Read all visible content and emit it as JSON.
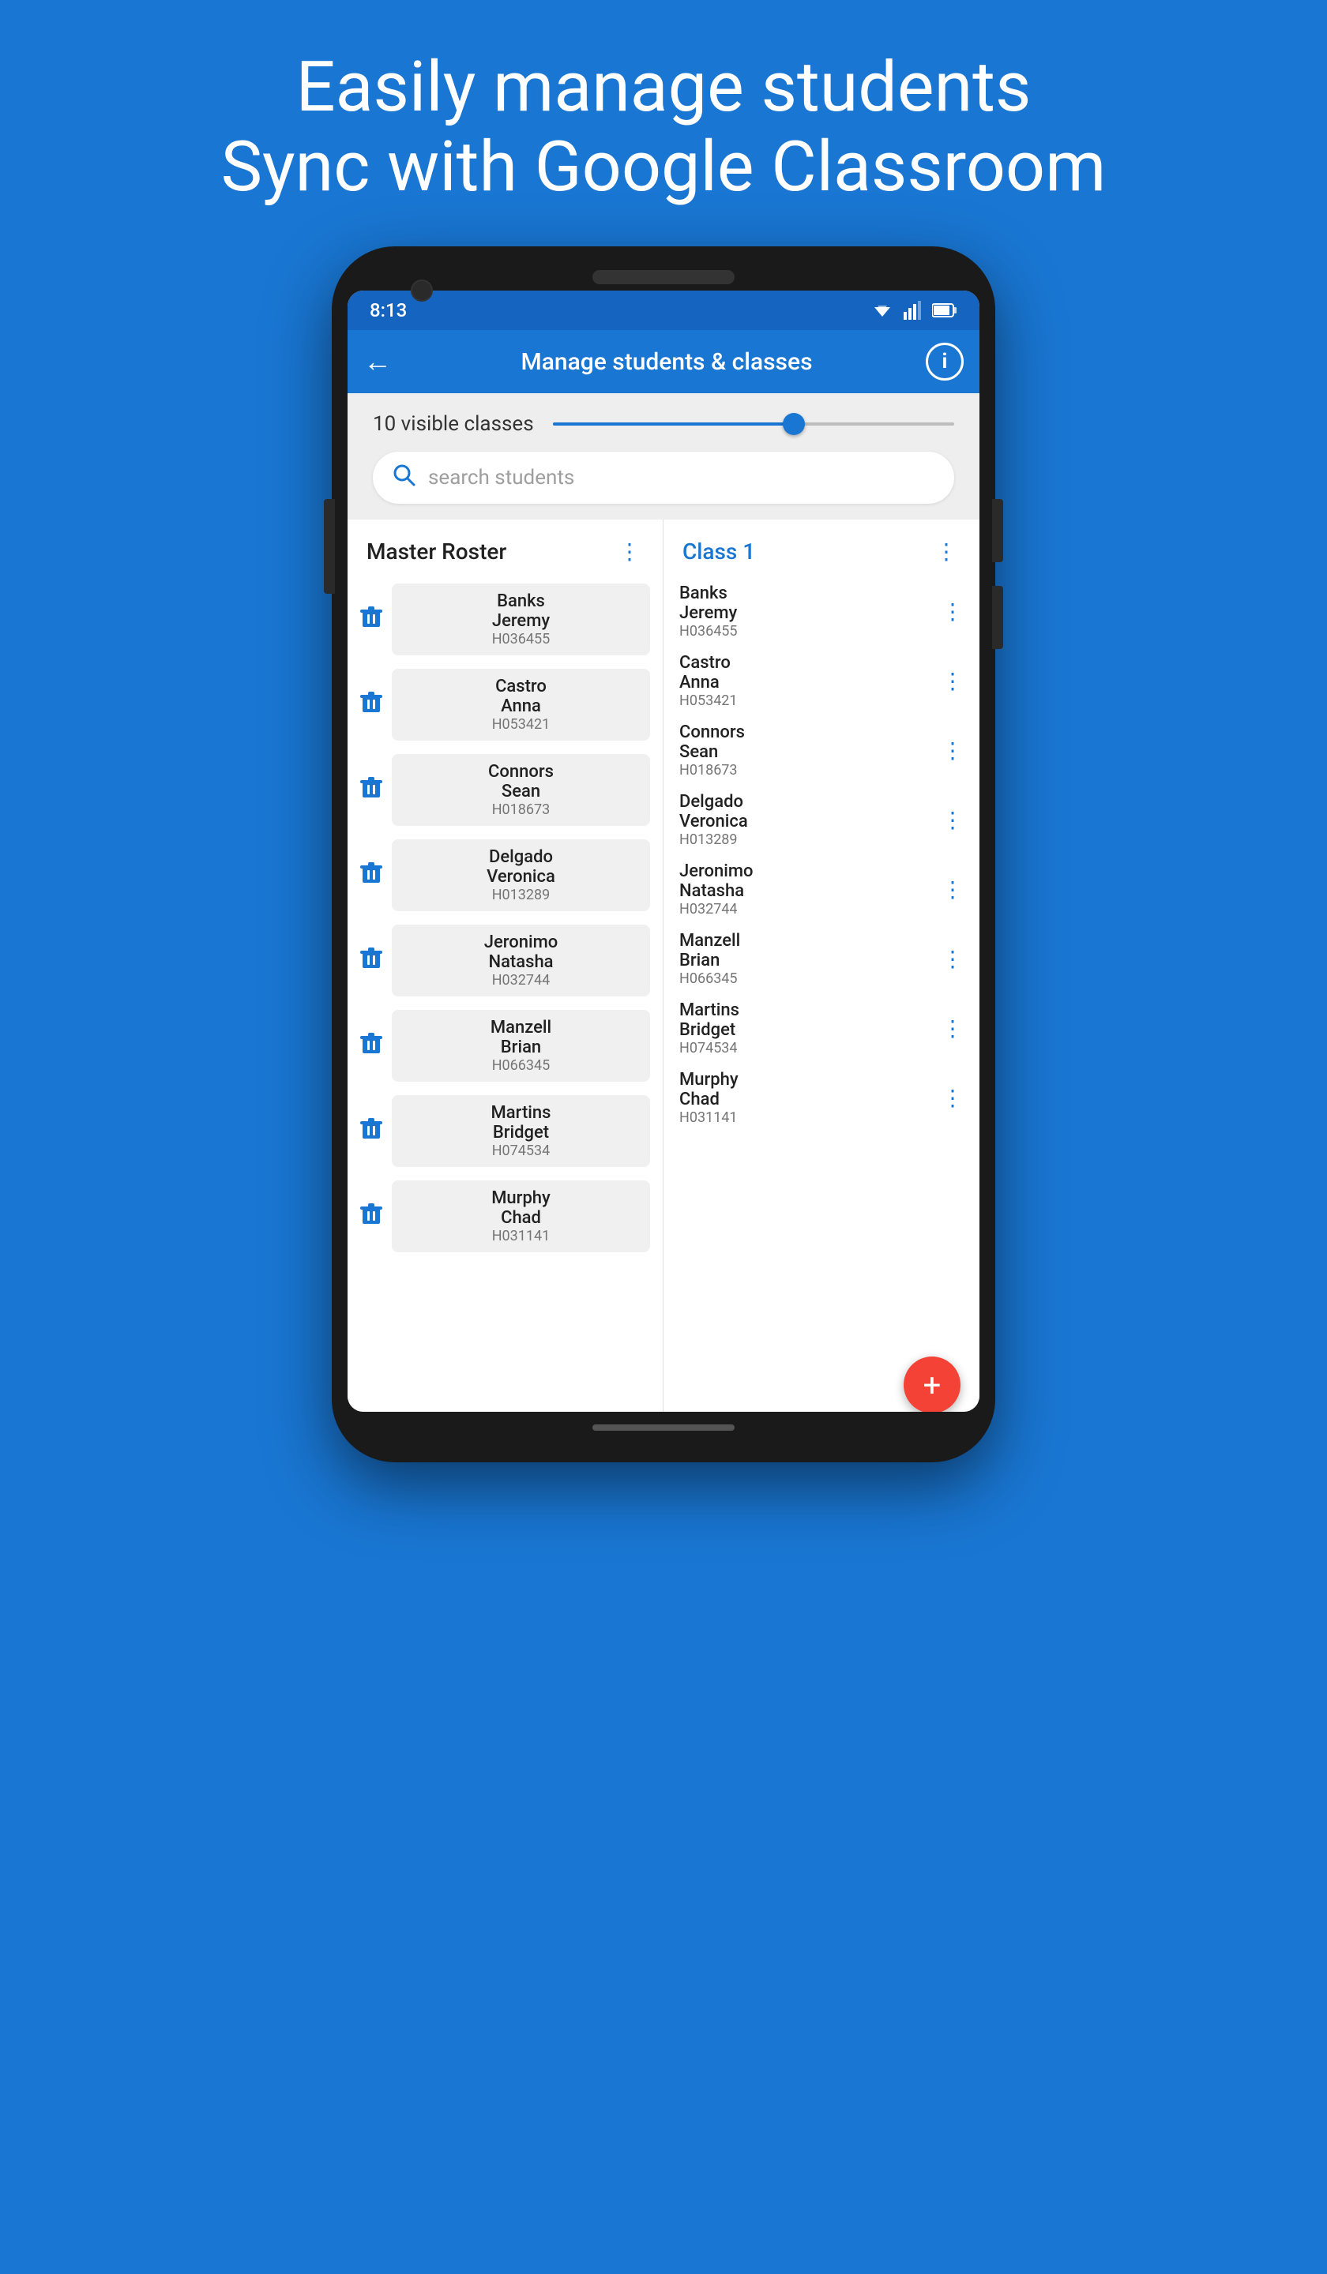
{
  "hero": {
    "line1": "Easily manage students",
    "line2": "Sync with Google Classroom"
  },
  "statusBar": {
    "time": "8:13"
  },
  "appBar": {
    "title": "Manage students & classes",
    "backLabel": "←",
    "infoLabel": "i"
  },
  "controls": {
    "visibleClassesLabel": "10 visible classes",
    "searchPlaceholder": "search students"
  },
  "masterRoster": {
    "title": "Master Roster",
    "students": [
      {
        "lastName": "Banks",
        "firstName": "Jeremy",
        "id": "H036455"
      },
      {
        "lastName": "Castro",
        "firstName": "Anna",
        "id": "H053421"
      },
      {
        "lastName": "Connors",
        "firstName": "Sean",
        "id": "H018673"
      },
      {
        "lastName": "Delgado",
        "firstName": "Veronica",
        "id": "H013289"
      },
      {
        "lastName": "Jeronimo",
        "firstName": "Natasha",
        "id": "H032744"
      },
      {
        "lastName": "Manzell",
        "firstName": "Brian",
        "id": "H066345"
      },
      {
        "lastName": "Martins",
        "firstName": "Bridget",
        "id": "H074534"
      },
      {
        "lastName": "Murphy",
        "firstName": "Chad",
        "id": "H031141"
      }
    ]
  },
  "classList": {
    "title": "Class 1",
    "students": [
      {
        "lastName": "Banks",
        "firstName": "Jeremy",
        "id": "H036455"
      },
      {
        "lastName": "Castro",
        "firstName": "Anna",
        "id": "H053421"
      },
      {
        "lastName": "Connors",
        "firstName": "Sean",
        "id": "H018673"
      },
      {
        "lastName": "Delgado",
        "firstName": "Veronica",
        "id": "H013289"
      },
      {
        "lastName": "Jeronimo",
        "firstName": "Natasha",
        "id": "H032744"
      },
      {
        "lastName": "Manzell",
        "firstName": "Brian",
        "id": "H066345"
      },
      {
        "lastName": "Martins",
        "firstName": "Bridget",
        "id": "H074534"
      },
      {
        "lastName": "Murphy",
        "firstName": "Chad",
        "id": "H031141"
      }
    ]
  },
  "fab": {
    "label": "+"
  },
  "colors": {
    "blue": "#1976D2",
    "darkBlue": "#1565C0",
    "red": "#F44336"
  }
}
